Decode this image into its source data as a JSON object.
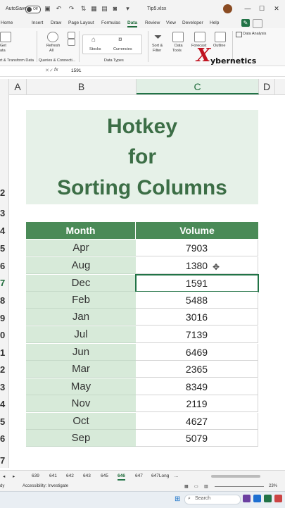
{
  "titlebar": {
    "autosave_label": "AutoSave",
    "toggle_state": "Off",
    "filename": "Tip5.xlsx",
    "window_controls": [
      "—",
      "☐",
      "✕"
    ]
  },
  "menu": {
    "tabs": [
      "Home",
      "Insert",
      "Draw",
      "Page Layout",
      "Formulas",
      "Data",
      "Review",
      "View",
      "Developer",
      "Help"
    ],
    "active_tab": "Data"
  },
  "ribbon": {
    "get_label": "Get",
    "get_sub": "ata",
    "refresh_label": "Refresh",
    "refresh_sub": "All",
    "group_transform": "rt & Transform Data",
    "group_queries": "Queries & Connecti...",
    "stocks_label": "Stocks",
    "currencies_label": "Currencies",
    "group_datatypes": "Data Types",
    "sort_filter_label": "Sort &",
    "sort_filter_sub": "Filter",
    "data_tools_label": "Data",
    "data_tools_sub": "Tools",
    "forecast_label": "Forecast",
    "outline_label": "Outline",
    "data_analysis_label": "Data Analysis",
    "logo_mark": "X",
    "logo_text": "ybernetics"
  },
  "formula_bar": {
    "fx": "fx",
    "value": "1591"
  },
  "columns": [
    "A",
    "B",
    "C",
    "D"
  ],
  "selected_column": "C",
  "row_numbers": [
    "2",
    "3",
    "4",
    "5",
    "6",
    "7",
    "8",
    "9",
    "0",
    "1",
    "2",
    "3",
    "4",
    "5",
    "6",
    "7"
  ],
  "sheet_title": {
    "line1": "Hotkey",
    "line2": "for",
    "line3": "Sorting Columns"
  },
  "table": {
    "headers": [
      "Month",
      "Volume"
    ],
    "rows": [
      {
        "month": "Apr",
        "volume": "7903"
      },
      {
        "month": "Aug",
        "volume": "1380"
      },
      {
        "month": "Dec",
        "volume": "1591"
      },
      {
        "month": "Feb",
        "volume": "5488"
      },
      {
        "month": "Jan",
        "volume": "3016"
      },
      {
        "month": "Jul",
        "volume": "7139"
      },
      {
        "month": "Jun",
        "volume": "6469"
      },
      {
        "month": "Mar",
        "volume": "2365"
      },
      {
        "month": "May",
        "volume": "8349"
      },
      {
        "month": "Nov",
        "volume": "2119"
      },
      {
        "month": "Oct",
        "volume": "4627"
      },
      {
        "month": "Sep",
        "volume": "5079"
      }
    ],
    "active_row": 2
  },
  "sheet_tabs": {
    "tabs": [
      "639",
      "641",
      "642",
      "643",
      "645",
      "646",
      "647",
      "647Long"
    ],
    "active": "646",
    "more": "..."
  },
  "status": {
    "ready": "dy",
    "accessibility": "Accessibility: Investigate",
    "zoom": "23%"
  },
  "taskbar": {
    "search_placeholder": "Search"
  },
  "colors": {
    "excel_green": "#217346",
    "header_fill": "#4a8a57",
    "month_fill": "#d7ead9",
    "title_fill": "#e6f1e8",
    "title_text": "#3c6e46",
    "logo_red": "#c1121f"
  }
}
